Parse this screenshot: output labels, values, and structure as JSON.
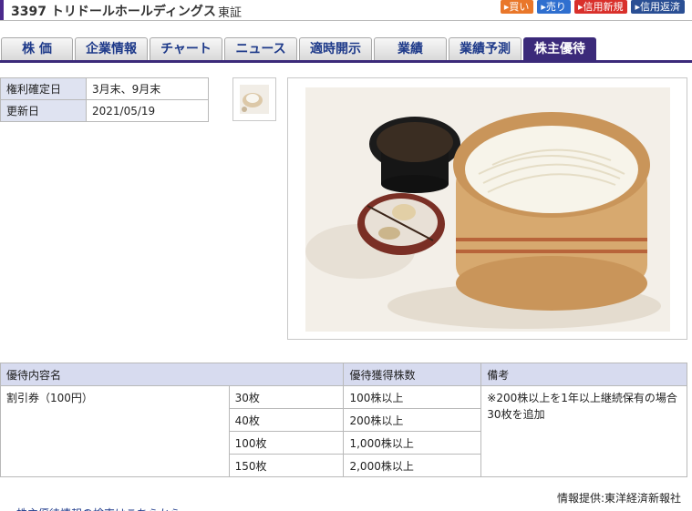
{
  "header": {
    "title": "3397 トリドールホールディングス",
    "market": "東証"
  },
  "actions": [
    {
      "label": "▸買い",
      "color": "#e9772a"
    },
    {
      "label": "▸売り",
      "color": "#2f6fcf"
    },
    {
      "label": "▸信用新規",
      "color": "#d9302b"
    },
    {
      "label": "▸信用返済",
      "color": "#2a4f94"
    }
  ],
  "tabs": [
    "株 価",
    "企業情報",
    "チャート",
    "ニュース",
    "適時開示",
    "業績",
    "業績予測",
    "株主優待"
  ],
  "info": [
    {
      "key": "権利確定日",
      "value": "3月末、9月末"
    },
    {
      "key": "更新日",
      "value": "2021/05/19"
    }
  ],
  "benefits": {
    "headers": [
      "優待内容名",
      "優待獲得株数",
      "備考"
    ],
    "name": "割引券（100円）",
    "rows": [
      {
        "count": "30枚",
        "shares": "100株以上"
      },
      {
        "count": "40枚",
        "shares": "200株以上"
      },
      {
        "count": "100枚",
        "shares": "1,000株以上"
      },
      {
        "count": "150枚",
        "shares": "2,000株以上"
      }
    ],
    "note": "※200株以上を1年以上継続保有の場合30枚を追加"
  },
  "credit": "情報提供:東洋経済新報社",
  "footer_link": "株主優待情報の検索はこちらから"
}
